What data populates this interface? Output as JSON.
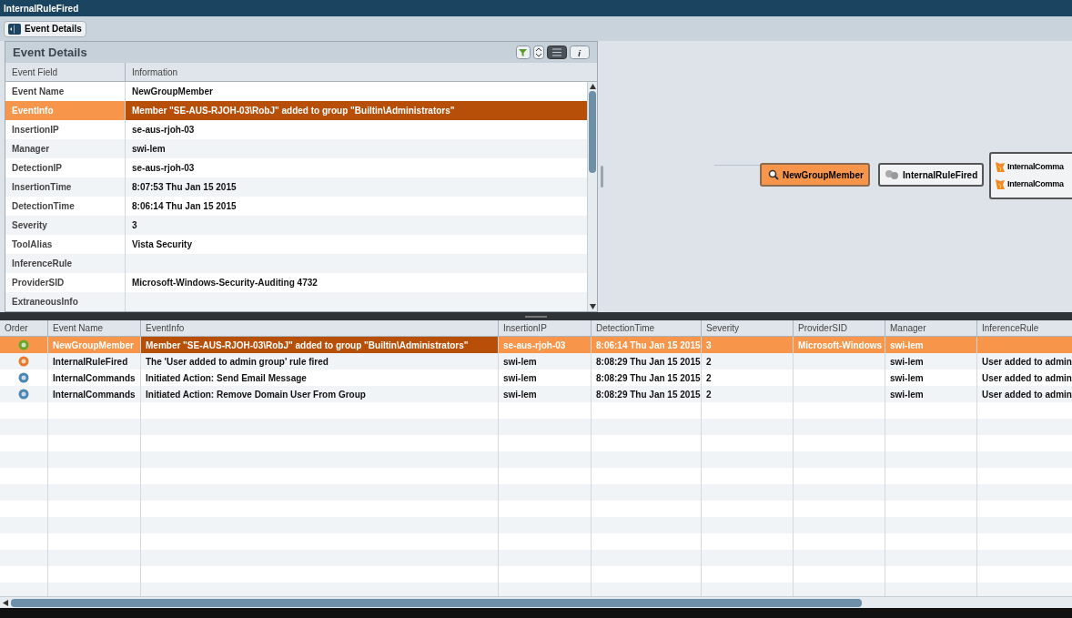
{
  "window": {
    "title": "InternalRuleFired"
  },
  "toolbar": {
    "button": "Event Details"
  },
  "details": {
    "title": "Event Details",
    "columns": [
      "Event Field",
      "Information"
    ],
    "rows": [
      {
        "field": "Event Name",
        "value": "NewGroupMember",
        "selected": false
      },
      {
        "field": "EventInfo",
        "value": "Member \"SE-AUS-RJOH-03\\RobJ\" added to group \"Builtin\\Administrators\"",
        "selected": true
      },
      {
        "field": "InsertionIP",
        "value": "se-aus-rjoh-03",
        "selected": false
      },
      {
        "field": "Manager",
        "value": "swi-lem",
        "selected": false
      },
      {
        "field": "DetectionIP",
        "value": "se-aus-rjoh-03",
        "selected": false
      },
      {
        "field": "InsertionTime",
        "value": "8:07:53 Thu Jan 15 2015",
        "selected": false
      },
      {
        "field": "DetectionTime",
        "value": "8:06:14 Thu Jan 15 2015",
        "selected": false
      },
      {
        "field": "Severity",
        "value": "3",
        "selected": false
      },
      {
        "field": "ToolAlias",
        "value": "Vista Security",
        "selected": false
      },
      {
        "field": "InferenceRule",
        "value": "",
        "selected": false
      },
      {
        "field": "ProviderSID",
        "value": "Microsoft-Windows-Security-Auditing 4732",
        "selected": false
      },
      {
        "field": "ExtraneousInfo",
        "value": "",
        "selected": false
      }
    ]
  },
  "graph": {
    "nodes": [
      {
        "label": "NewGroupMember",
        "kind": "event",
        "selected": true
      },
      {
        "label": "InternalRuleFired",
        "kind": "rule",
        "selected": false
      }
    ],
    "group": [
      {
        "label": "InternalComma"
      },
      {
        "label": "InternalComma"
      }
    ]
  },
  "events": {
    "columns": [
      "Order",
      "Event Name",
      "EventInfo",
      "InsertionIP",
      "DetectionTime",
      "Severity",
      "ProviderSID",
      "Manager",
      "InferenceRule"
    ],
    "rows": [
      {
        "color": "#6aa52e",
        "selected": true,
        "cells": [
          "",
          "NewGroupMember",
          "Member \"SE-AUS-RJOH-03\\RobJ\" added to group \"Builtin\\Administrators\"",
          "se-aus-rjoh-03",
          "8:06:14 Thu Jan 15 2015",
          "3",
          "Microsoft-Windows",
          "swi-lem",
          ""
        ]
      },
      {
        "color": "#e8782a",
        "selected": false,
        "cells": [
          "",
          "InternalRuleFired",
          "The 'User added to admin group' rule fired",
          "swi-lem",
          "8:08:29 Thu Jan 15 2015",
          "2",
          "",
          "swi-lem",
          "User added to admin"
        ]
      },
      {
        "color": "#4a86b4",
        "selected": false,
        "cells": [
          "",
          "InternalCommands",
          "Initiated Action: Send Email Message",
          "swi-lem",
          "8:08:29 Thu Jan 15 2015",
          "2",
          "",
          "swi-lem",
          "User added to admin"
        ]
      },
      {
        "color": "#4a86b4",
        "selected": false,
        "cells": [
          "",
          "InternalCommands",
          "Initiated Action: Remove Domain User From Group",
          "swi-lem",
          "8:08:29 Thu Jan 15 2015",
          "2",
          "",
          "swi-lem",
          "User added to admin"
        ]
      }
    ]
  }
}
